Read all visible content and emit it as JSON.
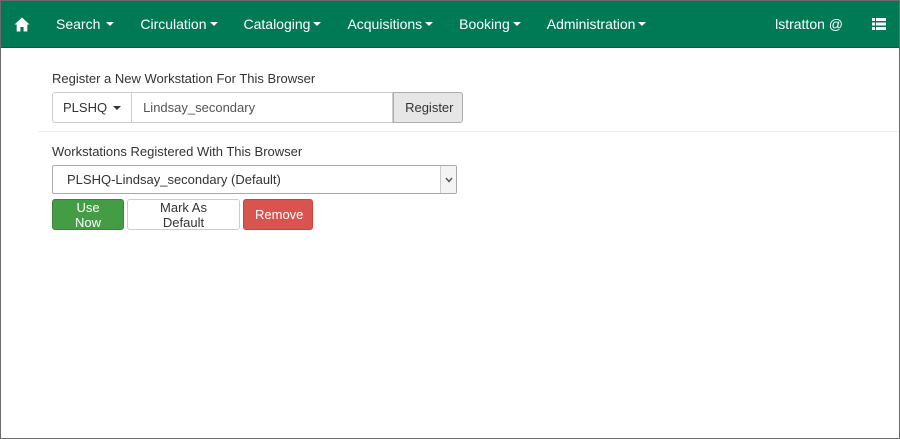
{
  "navbar": {
    "home_icon": "home-icon",
    "items": [
      {
        "label": "Search"
      },
      {
        "label": "Circulation"
      },
      {
        "label": "Cataloging"
      },
      {
        "label": "Acquisitions"
      },
      {
        "label": "Booking"
      },
      {
        "label": "Administration"
      }
    ],
    "user": "lstratton @",
    "menu_icon": "list-icon",
    "background_color": "#007a54"
  },
  "register": {
    "label": "Register a New Workstation For This Browser",
    "library": "PLSHQ",
    "input_value": "Lindsay_secondary",
    "button_label": "Register"
  },
  "workstations": {
    "label": "Workstations Registered With This Browser",
    "selected": "PLSHQ-Lindsay_secondary (Default)",
    "buttons": {
      "use_now": "Use Now",
      "mark_default": "Mark As Default",
      "remove": "Remove"
    }
  }
}
